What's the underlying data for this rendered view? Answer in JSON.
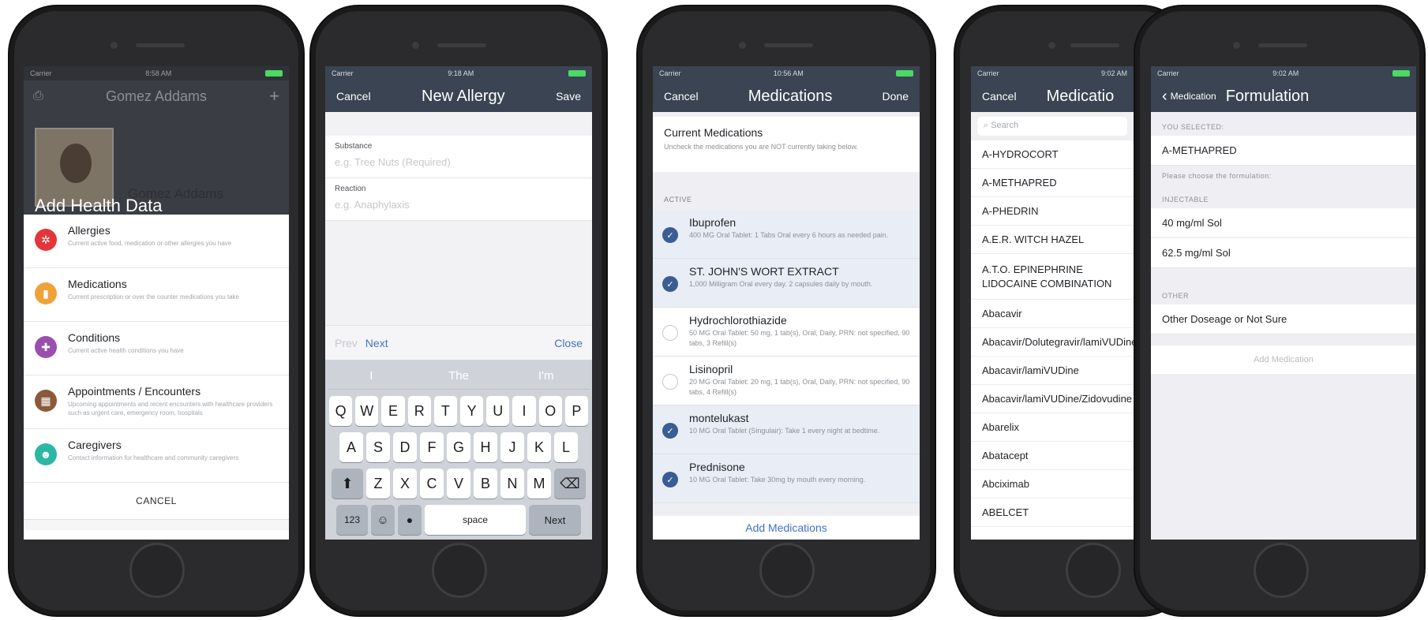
{
  "status": {
    "carrier": "Carrier",
    "times": [
      "8:58 AM",
      "9:18 AM",
      "10:56 AM",
      "9:02 AM",
      "9:02 AM"
    ]
  },
  "screen1": {
    "nav_title": "Gomez Addams",
    "nav_add": "+",
    "patient_name": "Gomez Addams",
    "sheet_title": "Add Health Data",
    "items": [
      {
        "title": "Allergies",
        "desc": "Current active food, medication or other allergies you have",
        "icon": "allergy-icon",
        "color": "#e2363b"
      },
      {
        "title": "Medications",
        "desc": "Current prescription or over the counter medications you take",
        "icon": "pill-icon",
        "color": "#f0a23a"
      },
      {
        "title": "Conditions",
        "desc": "Current active health conditions you have",
        "icon": "plus-icon",
        "color": "#9a4fae"
      },
      {
        "title": "Appointments / Encounters",
        "desc": "Upcoming appointments and recent encounters with healthcare providers such as urgent care, emergency room, hospitals",
        "icon": "hospital-icon",
        "color": "#8b5a3b"
      },
      {
        "title": "Caregivers",
        "desc": "Contact information for healthcare and community caregivers",
        "icon": "person-icon",
        "color": "#2cb7a5"
      }
    ],
    "cancel": "CANCEL"
  },
  "screen2": {
    "cancel": "Cancel",
    "title": "New Allergy",
    "save": "Save",
    "substance_label": "Substance",
    "substance_placeholder": "e.g. Tree Nuts (Required)",
    "reaction_label": "Reaction",
    "reaction_placeholder": "e.g. Anaphylaxis",
    "prev": "Prev",
    "next": "Next",
    "close": "Close",
    "suggestions": [
      "I",
      "The",
      "I'm"
    ],
    "keys_row1": [
      "Q",
      "W",
      "E",
      "R",
      "T",
      "Y",
      "U",
      "I",
      "O",
      "P"
    ],
    "keys_row2": [
      "A",
      "S",
      "D",
      "F",
      "G",
      "H",
      "J",
      "K",
      "L"
    ],
    "keys_row3": [
      "Z",
      "X",
      "C",
      "V",
      "B",
      "N",
      "M"
    ],
    "key_123": "123",
    "key_space": "space",
    "key_next": "Next"
  },
  "screen3": {
    "cancel": "Cancel",
    "title": "Medications",
    "done": "Done",
    "header_title": "Current Medications",
    "header_sub": "Uncheck the medications you are NOT currently taking below.",
    "section": "ACTIVE",
    "meds": [
      {
        "name": "Ibuprofen",
        "detail": "400 MG Oral Tablet: 1 Tabs Oral every 6 hours as needed pain.",
        "checked": true
      },
      {
        "name": "ST. JOHN'S WORT EXTRACT",
        "detail": "1,000 Milligram Oral every day. 2 capsules daily by mouth.",
        "checked": true
      },
      {
        "name": "Hydrochlorothiazide",
        "detail": "50 MG Oral Tablet: 50 mg, 1 tab(s), Oral, Daily, PRN: not specified, 90 tabs, 3 Refill(s)",
        "checked": false
      },
      {
        "name": "Lisinopril",
        "detail": "20 MG Oral Tablet: 20 mg, 1 tab(s), Oral, Daily, PRN: not specified, 90 tabs, 4 Refill(s)",
        "checked": false
      },
      {
        "name": "montelukast",
        "detail": "10 MG Oral Tablet (Singulair): Take 1 every night at bedtime.",
        "checked": true
      },
      {
        "name": "Prednisone",
        "detail": "10 MG Oral Tablet: Take 30mg by mouth every morning.",
        "checked": true
      }
    ],
    "add": "Add Medications"
  },
  "screen4": {
    "cancel": "Cancel",
    "title": "Medicatio",
    "search_placeholder": "Search",
    "items": [
      "A-HYDROCORT",
      "A-METHAPRED",
      "A-PHEDRIN",
      "A.E.R. WITCH HAZEL",
      "A.T.O. EPINEPHRINE LIDOCAINE COMBINATION",
      "Abacavir",
      "Abacavir/Dolutegravir/lamiVUDine",
      "Abacavir/lamiVUDine",
      "Abacavir/lamiVUDine/Zidovudine",
      "Abarelix",
      "Abatacept",
      "Abciximab",
      "ABELCET"
    ]
  },
  "screen5": {
    "back": "Medication",
    "title": "Formulation",
    "you_selected": "YOU SELECTED:",
    "selected": "A-METHAPRED",
    "choose": "Please choose the formulation:",
    "injectable": "INJECTABLE",
    "forms": [
      "40 mg/ml Sol",
      "62.5 mg/ml Sol"
    ],
    "other": "OTHER",
    "other_item": "Other Doseage or Not Sure",
    "add": "Add Medication"
  }
}
